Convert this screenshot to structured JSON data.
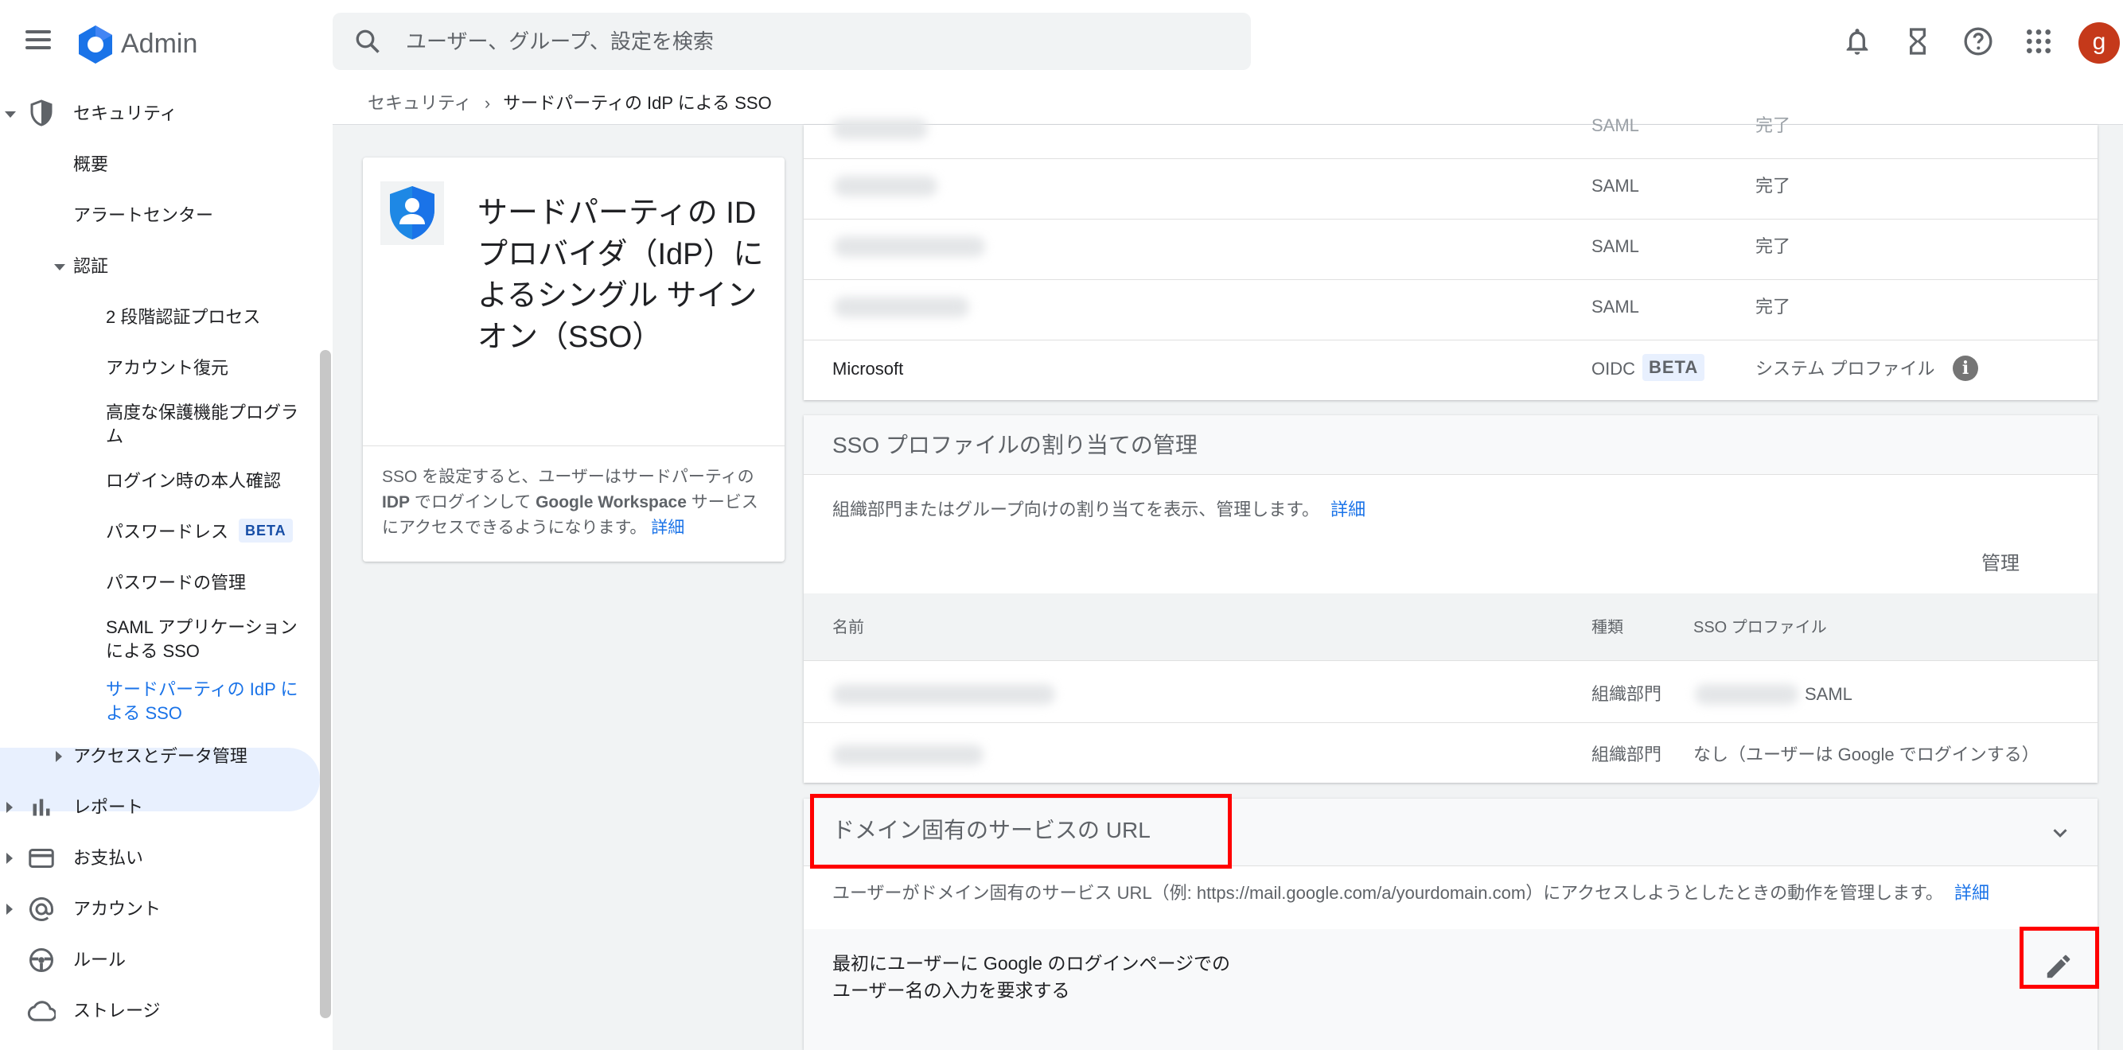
{
  "app": {
    "name": "Admin"
  },
  "search": {
    "placeholder": "ユーザー、グループ、設定を検索"
  },
  "header": {
    "avatar_letter": "g"
  },
  "sidebar": {
    "security": "セキュリティ",
    "overview": "概要",
    "alert_center": "アラートセンター",
    "auth": "認証",
    "two_step": "2 段階認証プロセス",
    "account_recovery": "アカウント復元",
    "advanced_protection": "高度な保護機能プログラム",
    "login_challenge": "ログイン時の本人確認",
    "passwordless": "パスワードレス",
    "passwordless_badge": "BETA",
    "password_management": "パスワードの管理",
    "saml_sso": "SAML アプリケーションによる SSO",
    "third_party_sso": "サードパーティの IdP による SSO",
    "access_data": "アクセスとデータ管理",
    "reports": "レポート",
    "billing": "お支払い",
    "account": "アカウント",
    "rules": "ルール",
    "storage": "ストレージ"
  },
  "breadcrumb": {
    "parent": "セキュリティ",
    "separator": "›",
    "current": "サードパーティの IdP による SSO"
  },
  "info_card": {
    "title": "サードパーティの ID プロバイダ（IdP）によるシングル サインオン（SSO）",
    "desc_a": "SSO を設定すると、ユーザーはサードパーティの ",
    "desc_b": "IDP",
    "desc_c": " でログインして ",
    "desc_d": "Google Workspace",
    "desc_e": " サービスにアクセスできるようになります。",
    "link": "詳細"
  },
  "profiles": {
    "rows": [
      {
        "type": "SAML",
        "status": "完了"
      },
      {
        "type": "SAML",
        "status": "完了"
      },
      {
        "type": "SAML",
        "status": "完了"
      },
      {
        "type": "SAML",
        "status": "完了"
      }
    ],
    "microsoft": {
      "name": "Microsoft",
      "type": "OIDC",
      "badge": "BETA",
      "status": "システム プロファイル"
    }
  },
  "assignment": {
    "title": "SSO プロファイルの割り当ての管理",
    "desc": "組織部門またはグループ向けの割り当てを表示、管理します。",
    "link": "詳細",
    "manage": "管理",
    "columns": {
      "name": "名前",
      "kind": "種類",
      "profile": "SSO プロファイル"
    },
    "rows": [
      {
        "kind": "組織部門",
        "profile": "SAML"
      },
      {
        "kind": "組織部門",
        "profile": "なし（ユーザーは Google でログインする）"
      }
    ]
  },
  "domain_url": {
    "title": "ドメイン固有のサービスの URL",
    "desc": "ユーザーがドメイン固有のサービス URL（例: https://mail.google.com/a/yourdomain.com）にアクセスしようとしたときの動作を管理します。",
    "link": "詳細",
    "setting": "最初にユーザーに Google のログインページでのユーザー名の入力を要求する"
  },
  "colors": {
    "accent": "#1a73e8",
    "highlight": "#ff0000",
    "avatar": "#c5391a"
  }
}
